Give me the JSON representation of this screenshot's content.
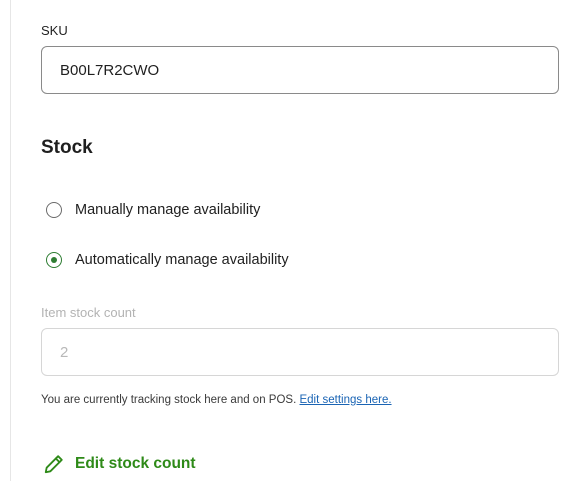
{
  "sku": {
    "label": "SKU",
    "value": "B00L7R2CWO"
  },
  "stock": {
    "title": "Stock",
    "options": [
      {
        "label": "Manually manage availability",
        "selected": false
      },
      {
        "label": "Automatically manage availability",
        "selected": true
      }
    ],
    "count_label": "Item stock count",
    "count_value": "2",
    "help_text": "You are currently tracking stock here and on POS.",
    "help_link": "Edit settings here.",
    "edit_label": "Edit stock count",
    "edit_icon": "pencil-icon"
  },
  "colors": {
    "accent_green": "#2e8a18",
    "link_blue": "#1a64b4"
  }
}
